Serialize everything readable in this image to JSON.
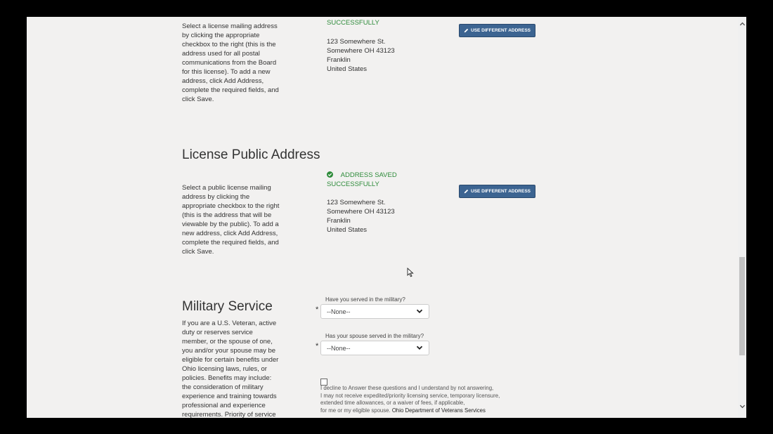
{
  "mailing": {
    "status_tail": "SUCCESSFULLY",
    "description": "Select a license mailing address by clicking the appropriate checkbox to the right (this is the address used for all postal communications from the Board for this license). To add a new address, click Add Address, complete the required fields, and click Save.",
    "address": [
      "123 Somewhere St.",
      "Somewhere OH 43123",
      "Franklin",
      "United States"
    ],
    "button_label": "USE DIFFERENT ADDRESS",
    "button_icon": "pencil-icon"
  },
  "public": {
    "heading": "License Public Address",
    "description": "Select a public license mailing address by clicking the appropriate checkbox to the right (this is the address that will be viewable by the public). To add a new address, click Add Address, complete the required fields, and click Save.",
    "status_line1": "ADDRESS SAVED",
    "status_line2": "SUCCESSFULLY",
    "status_icon": "check-circle-icon",
    "address": [
      "123 Somewhere St.",
      "Somewhere OH 43123",
      "Franklin",
      "United States"
    ],
    "button_label": "USE DIFFERENT ADDRESS",
    "button_icon": "pencil-icon"
  },
  "military": {
    "heading": "Military Service",
    "description": "If you are a U.S. Veteran, active duty or reserves service member, or the spouse of one, you and/or your spouse may be eligible for certain benefits under Ohio licensing laws, rules, or policies. Benefits may include: the consideration of military experience and training towards professional and experience requirements. Priority of service",
    "q1_label": "Have you served in the military?",
    "q1_value": "--None--",
    "q2_label": "Has your spouse served in the military?",
    "q2_value": "--None--",
    "required_mark": "*",
    "decline_lines": [
      "I decline to Answer these questions and I understand by not answering,",
      "I may not receive expedited/priority licensing service, temporary licensure,",
      "extended time allowances, or a waiver of fees, if applicable,"
    ],
    "decline_last_prefix": "for me or my eligible spouse. ",
    "decline_last_strong": "Ohio Department of Veterans Services"
  },
  "colors": {
    "success": "#2e8b3a",
    "button": "#3c6491",
    "background": "#f2f1f0"
  }
}
